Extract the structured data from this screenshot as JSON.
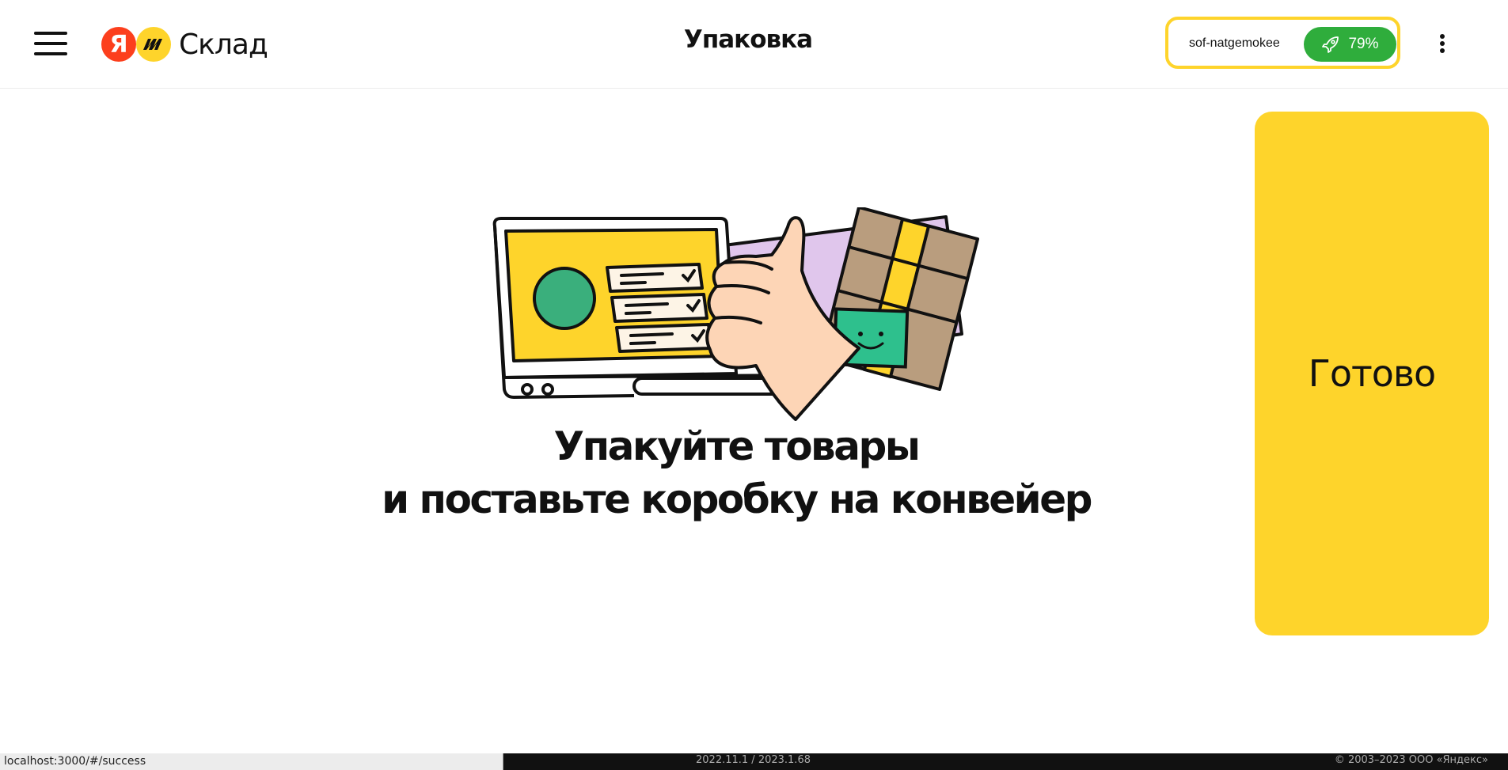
{
  "header": {
    "menu_icon": "hamburger-menu-icon",
    "logo": {
      "ya_letter": "Я",
      "product_name": "Склад"
    },
    "title": "Упаковка",
    "user": {
      "login": "sof-natgemokee",
      "progress_icon": "rocket-icon",
      "progress_label": "79%",
      "progress_value": 79
    },
    "more_icon": "vertical-dots-icon"
  },
  "main": {
    "illustration_icon": "packing-success-illustration",
    "message_line1": "Упакуйте товары",
    "message_line2": "и поставьте коробку на конвейер",
    "done_label": "Готово"
  },
  "statusbar": {
    "url": "localhost:3000/#/success",
    "version": "2022.11.1 / 2023.1.68",
    "copyright": "© 2003–2023 ООО «Яндекс»"
  },
  "colors": {
    "accent_yellow": "#fed42b",
    "progress_green": "#2fad3c",
    "logo_red": "#fc3f1d"
  }
}
